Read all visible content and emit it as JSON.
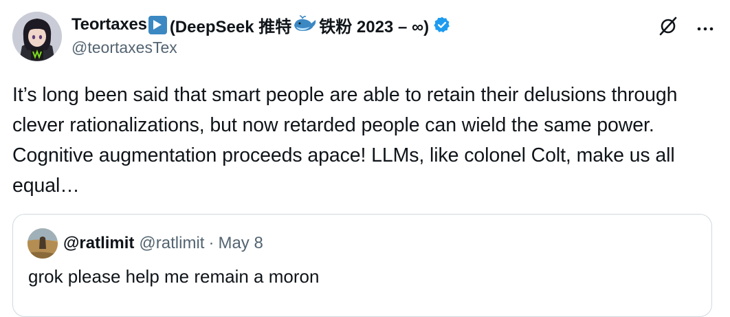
{
  "author": {
    "display_name": "Teortaxes",
    "paren_prefix": "(DeepSeek 推特",
    "paren_suffix": "铁粉 2023 – ∞)",
    "handle": "@teortaxesTex"
  },
  "icons": {
    "avatar": "anime-character-avatar",
    "play_badge": "play-button-emoji-icon",
    "whale": "whale-emoji-icon",
    "verified": "verified-badge-icon",
    "grok": "grok-icon",
    "more": "more-icon"
  },
  "tweet": {
    "text": "It’s long been said that smart people are able to retain their delusions through clever rationalizations, but now retarded people can wield the same power. Cognitive augmentation proceeds apace! LLMs, like colonel Colt, make us all equal…"
  },
  "quote": {
    "name": "@ratlimit",
    "handle": "@ratlimit",
    "separator": "·",
    "date": "May 8",
    "text": "grok please help me remain a moron"
  },
  "colors": {
    "text": "#0f1419",
    "secondary": "#536471",
    "verified": "#1d9bf0",
    "border": "#cfd9de"
  }
}
